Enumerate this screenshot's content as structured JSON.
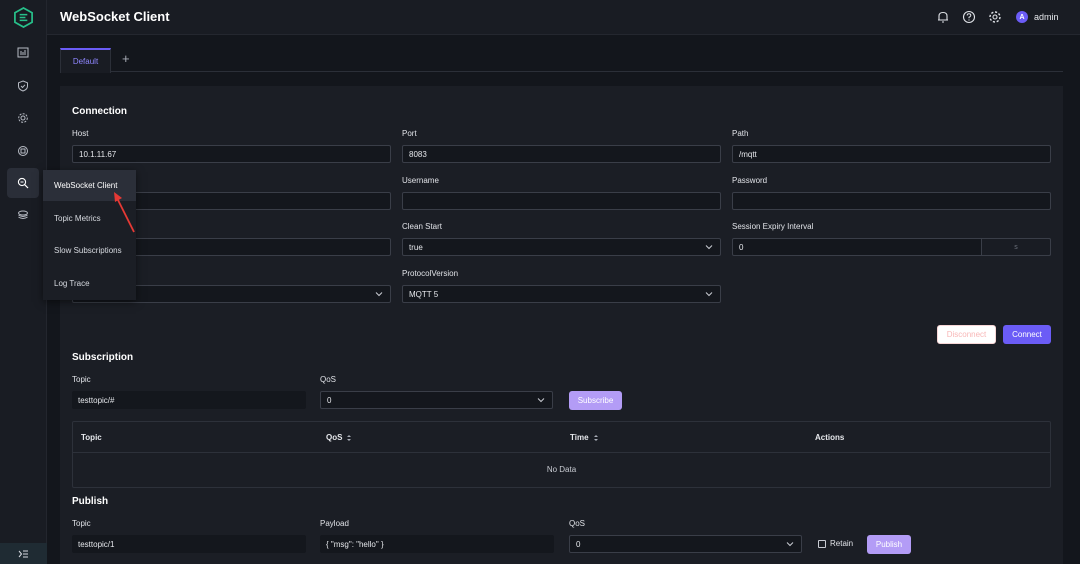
{
  "header": {
    "title": "WebSocket Client",
    "user_initial": "A",
    "user_name": "admin"
  },
  "submenu": {
    "items": [
      {
        "label": "WebSocket Client",
        "active": true
      },
      {
        "label": "Topic Metrics",
        "active": false
      },
      {
        "label": "Slow Subscriptions",
        "active": false
      },
      {
        "label": "Log Trace",
        "active": false
      }
    ]
  },
  "tabs": {
    "items": [
      {
        "label": "Default"
      }
    ],
    "add_label": "+"
  },
  "connection": {
    "title": "Connection",
    "host_label": "Host",
    "host_value": "10.1.11.67",
    "port_label": "Port",
    "port_value": "8083",
    "path_label": "Path",
    "path_value": "/mqtt",
    "username_label": "Username",
    "username_value": "",
    "password_label": "Password",
    "password_value": "",
    "clean_start_label": "Clean Start",
    "clean_start_value": "true",
    "session_expiry_label": "Session Expiry Interval",
    "session_expiry_value": "0",
    "session_expiry_unit": "s",
    "protocol_label": "ProtocolVersion",
    "protocol_value": "MQTT 5",
    "disconnect_label": "Disconnect",
    "connect_label": "Connect"
  },
  "subscription": {
    "title": "Subscription",
    "topic_label": "Topic",
    "topic_value": "testtopic/#",
    "qos_label": "QoS",
    "qos_value": "0",
    "subscribe_label": "Subscribe",
    "table": {
      "columns": [
        "Topic",
        "QoS",
        "Time",
        "Actions"
      ],
      "empty_text": "No Data"
    }
  },
  "publish": {
    "title": "Publish",
    "topic_label": "Topic",
    "topic_value": "testtopic/1",
    "payload_label": "Payload",
    "payload_value": "{ \"msg\": \"hello\" }",
    "qos_label": "QoS",
    "qos_value": "0",
    "retain_label": "Retain",
    "publish_label": "Publish"
  },
  "colors": {
    "accent": "#6b5cf6",
    "brand": "#27c08a",
    "annotation": "#e53935"
  }
}
